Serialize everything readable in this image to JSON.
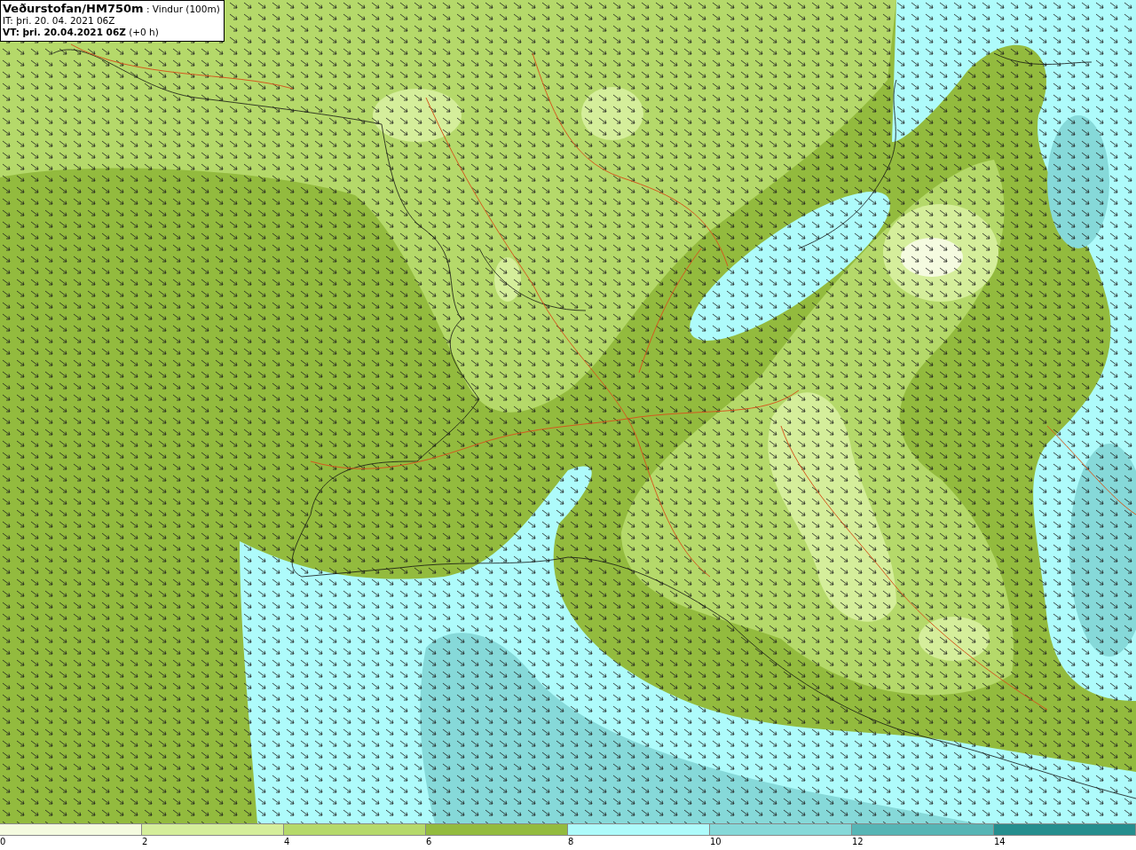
{
  "header": {
    "lines": [
      "**Veðurstofan/HM750m** : Vindur (100m)",
      "IT: þri. 20. 04. 2021 06Z",
      "**VT: þri. 20.04.2021 06Z** (+0 h)"
    ]
  },
  "legend": [
    {
      "label": "0",
      "color": "#f5fbe0"
    },
    {
      "label": "2",
      "color": "#d5ee9b"
    },
    {
      "label": "4",
      "color": "#b5d96a"
    },
    {
      "label": "6",
      "color": "#93bb3e"
    },
    {
      "label": "8",
      "color": "#aefbfb"
    },
    {
      "label": "10",
      "color": "#86d9d9"
    },
    {
      "label": "12",
      "color": "#56b5b5"
    },
    {
      "label": "14",
      "color": "#258e8e"
    }
  ]
}
